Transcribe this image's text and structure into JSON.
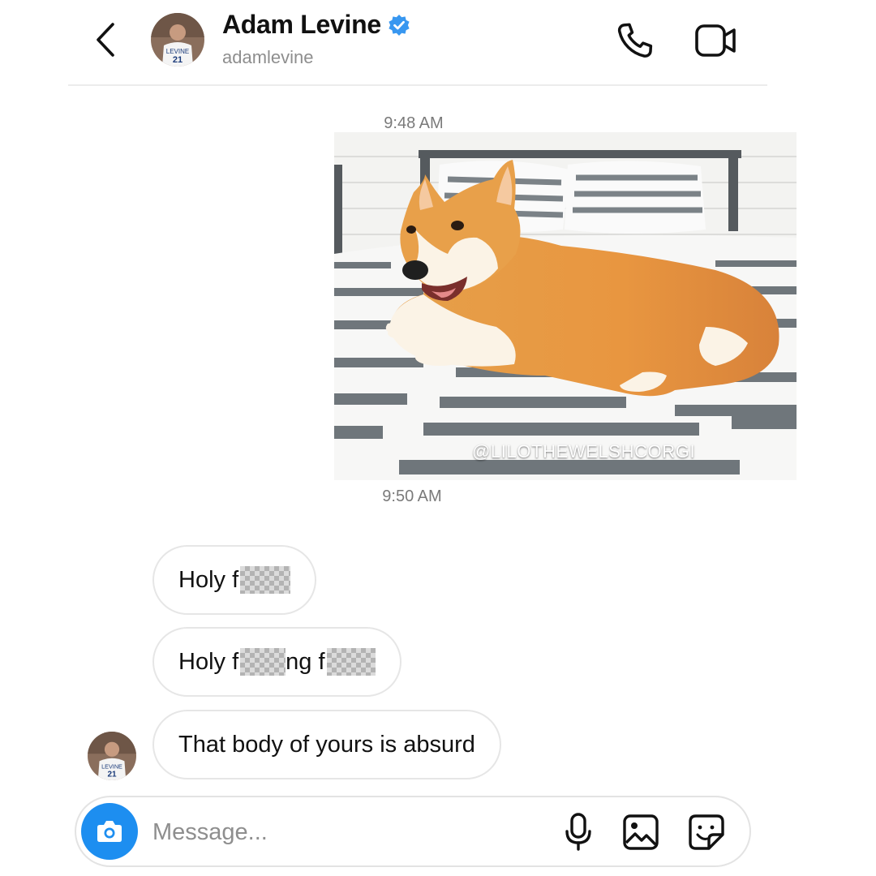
{
  "header": {
    "back_icon": "chevron-left-icon",
    "name": "Adam Levine",
    "verified_icon": "verified-badge-icon",
    "verified_color": "#3897f0",
    "handle": "adamlevine",
    "call_icon": "phone-icon",
    "video_icon": "video-camera-icon",
    "avatar_jersey_name": "LEVINE",
    "avatar_jersey_number": "21"
  },
  "thread": {
    "timestamp_1": "9:48 AM",
    "photo": {
      "watermark": "@LILOTHEWELSHCORGI"
    },
    "timestamp_2": "9:50 AM",
    "messages": [
      {
        "prefix": "Holy f",
        "segments": []
      },
      {
        "prefix": "Holy f",
        "middle": "ng f"
      },
      {
        "text": "That body of yours is absurd"
      }
    ]
  },
  "composer": {
    "camera_icon": "camera-icon",
    "camera_color": "#1d8ef0",
    "placeholder": "Message...",
    "mic_icon": "microphone-icon",
    "gallery_icon": "image-gallery-icon",
    "sticker_icon": "sticker-icon"
  }
}
